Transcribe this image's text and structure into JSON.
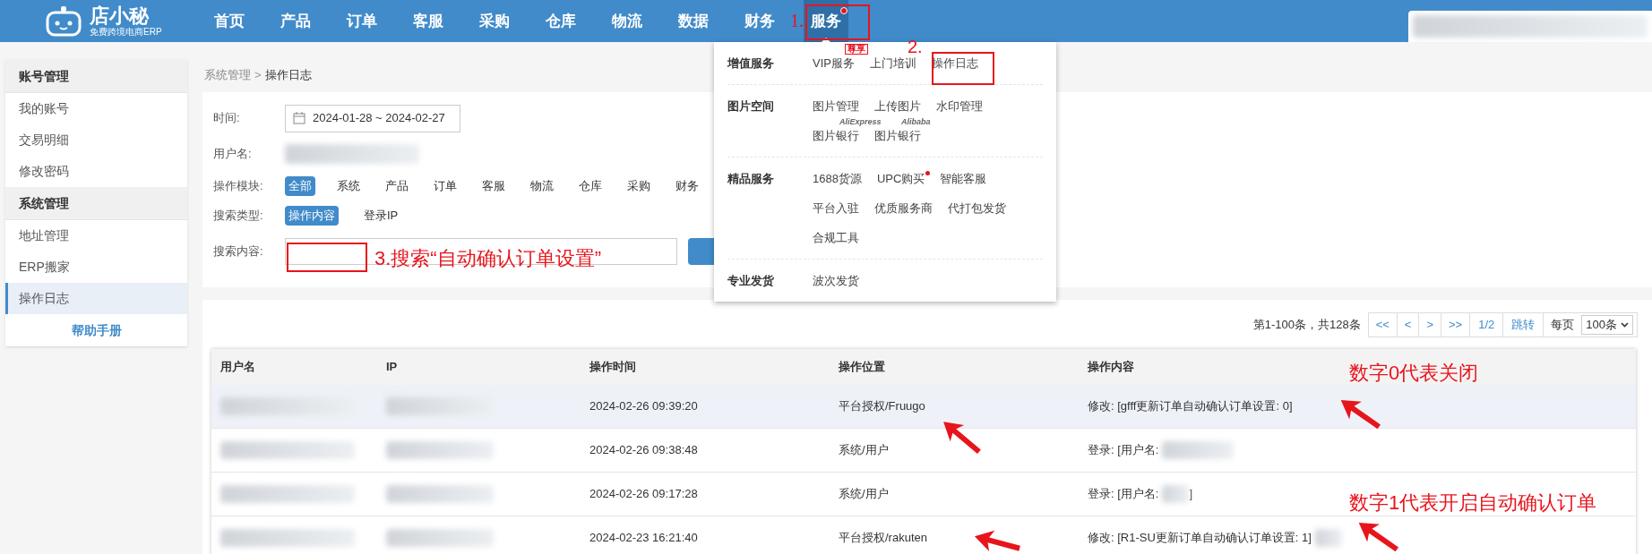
{
  "logo": {
    "name": "店小秘",
    "tagline": "免费跨境电商ERP"
  },
  "nav": [
    {
      "label": "首页",
      "selected": false,
      "dot": false
    },
    {
      "label": "产品",
      "selected": false,
      "dot": false
    },
    {
      "label": "订单",
      "selected": false,
      "dot": false
    },
    {
      "label": "客服",
      "selected": false,
      "dot": false
    },
    {
      "label": "采购",
      "selected": false,
      "dot": false
    },
    {
      "label": "仓库",
      "selected": false,
      "dot": false
    },
    {
      "label": "物流",
      "selected": false,
      "dot": false
    },
    {
      "label": "数据",
      "selected": false,
      "dot": false
    },
    {
      "label": "财务",
      "selected": false,
      "dot": false
    },
    {
      "label": "服务",
      "selected": true,
      "dot": true
    }
  ],
  "sidebar": {
    "sections": [
      {
        "title": "账号管理",
        "items": [
          {
            "label": "我的账号",
            "selected": false
          },
          {
            "label": "交易明细",
            "selected": false
          },
          {
            "label": "修改密码",
            "selected": false
          }
        ]
      },
      {
        "title": "系统管理",
        "items": [
          {
            "label": "地址管理",
            "selected": false
          },
          {
            "label": "ERP搬家",
            "selected": false
          },
          {
            "label": "操作日志",
            "selected": true
          }
        ]
      }
    ],
    "help_link": "帮助手册"
  },
  "breadcrumb": {
    "parent": "系统管理",
    "separator": ">",
    "current": "操作日志"
  },
  "filters": {
    "time_label": "时间:",
    "date_range": "2024-01-28 ~ 2024-02-27",
    "user_label": "用户名:",
    "module_label": "操作模块:",
    "modules": [
      {
        "label": "全部",
        "selected": true
      },
      {
        "label": "系统",
        "selected": false
      },
      {
        "label": "产品",
        "selected": false
      },
      {
        "label": "订单",
        "selected": false
      },
      {
        "label": "客服",
        "selected": false
      },
      {
        "label": "物流",
        "selected": false
      },
      {
        "label": "仓库",
        "selected": false
      },
      {
        "label": "采购",
        "selected": false
      },
      {
        "label": "财务",
        "selected": false
      }
    ],
    "search_type_label": "搜索类型:",
    "search_types": [
      {
        "label": "操作内容",
        "selected": true
      },
      {
        "label": "登录IP",
        "selected": false
      }
    ],
    "search_label": "搜索内容:"
  },
  "pagination": {
    "summary": "第1-100条，共128条",
    "buttons": [
      "<<",
      "<",
      ">",
      ">>"
    ],
    "page": "1/2",
    "jump": "跳转",
    "per_page_label": "每页",
    "per_page": "100条"
  },
  "table": {
    "columns": [
      "用户名",
      "IP",
      "操作时间",
      "操作位置",
      "操作内容"
    ],
    "rows": [
      {
        "time": "2024-02-26 09:39:20",
        "location": "平台授权/Fruugo",
        "content": "修改: [gfff更新订单自动确认订单设置: 0]",
        "highlighted": true
      },
      {
        "time": "2024-02-26 09:38:48",
        "location": "系统/用户",
        "content": "登录: [用户名:",
        "highlighted": false
      },
      {
        "time": "2024-02-26 09:17:28",
        "location": "系统/用户",
        "content": "登录: [用户名:",
        "content_end": "]",
        "highlighted": false
      },
      {
        "time": "2024-02-23 16:21:40",
        "location": "平台授权/rakuten",
        "content": "修改: [R1-SU更新订单自动确认订单设置: 1]",
        "highlighted": false
      }
    ]
  },
  "dropdown": {
    "groups": [
      {
        "title": "增值服务",
        "items": [
          {
            "label": "VIP服务",
            "tag": "尊享",
            "dot": false
          },
          {
            "label": "上门培训",
            "dot": false
          },
          {
            "label": "操作日志",
            "dot": false
          }
        ]
      },
      {
        "title": "图片空间",
        "items": [
          {
            "label": "图片管理",
            "dot": false
          },
          {
            "label": "上传图片",
            "dot": false
          },
          {
            "label": "水印管理",
            "dot": false
          },
          {
            "label": "图片银行",
            "note": "AliExpress",
            "dot": false
          },
          {
            "label": "图片银行",
            "note": "Alibaba",
            "dot": false
          }
        ]
      },
      {
        "title": "精品服务",
        "items": [
          {
            "label": "1688货源",
            "dot": false
          },
          {
            "label": "UPC购买",
            "dot": true
          },
          {
            "label": "智能客服",
            "dot": false
          },
          {
            "label": "平台入驻",
            "dot": false
          },
          {
            "label": "优质服务商",
            "dot": false
          },
          {
            "label": "代打包发货",
            "dot": false
          },
          {
            "label": "合规工具",
            "dot": false
          }
        ]
      },
      {
        "title": "专业发货",
        "items": [
          {
            "label": "波次发货",
            "dot": false
          }
        ]
      }
    ]
  },
  "annotations": [
    "1.",
    "2.",
    "3.搜索“自动确认订单设置”",
    "数字0代表关闭",
    "数字1代表开启自动确认订单"
  ]
}
